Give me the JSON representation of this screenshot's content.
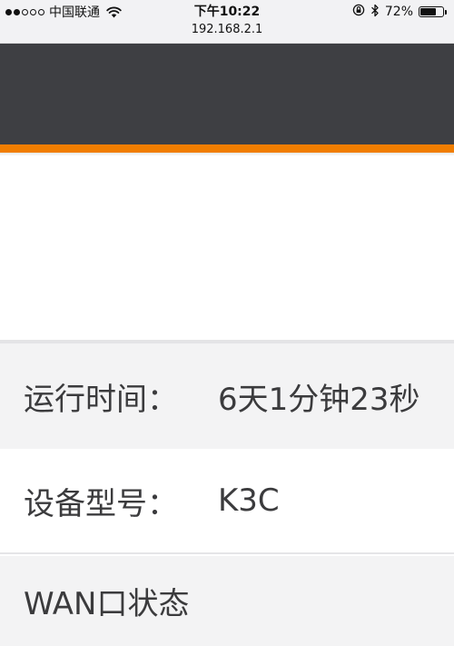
{
  "status_bar": {
    "carrier": "中国联通",
    "time": "下午10:22",
    "battery_percent_label": "72%",
    "battery_level": 0.72,
    "signal_strength": 2,
    "signal_max": 5
  },
  "browser": {
    "url": "192.168.2.1"
  },
  "colors": {
    "header_bg": "#3e3f43",
    "accent": "#f07d00",
    "row_alt_bg": "#f3f3f4"
  },
  "info": {
    "uptime": {
      "label": "运行时间：",
      "value": "6天1分钟23秒"
    },
    "model": {
      "label": "设备型号：",
      "value": "K3C"
    },
    "wan": {
      "label": "WAN口状态"
    }
  }
}
